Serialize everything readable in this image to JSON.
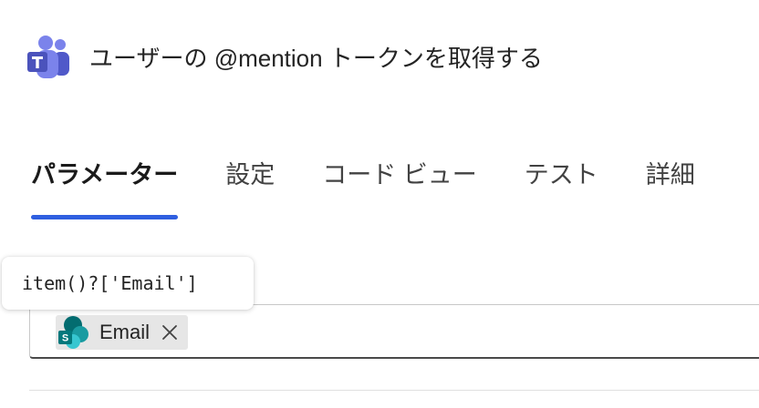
{
  "header": {
    "icon": "teams-icon",
    "title": "ユーザーの @mention トークンを取得する"
  },
  "tabs": [
    {
      "label": "パラメーター",
      "active": true
    },
    {
      "label": "設定",
      "active": false
    },
    {
      "label": "コード ビュー",
      "active": false
    },
    {
      "label": "テスト",
      "active": false
    },
    {
      "label": "詳細",
      "active": false
    }
  ],
  "tooltip": {
    "text": "item()?['Email']"
  },
  "field": {
    "token": {
      "icon": "sharepoint-icon",
      "label": "Email",
      "remove_icon": "close-icon"
    }
  },
  "colors": {
    "accent": "#2f5fe0",
    "teams_purple": "#5b5fc7",
    "sharepoint_teal": "#038387"
  }
}
